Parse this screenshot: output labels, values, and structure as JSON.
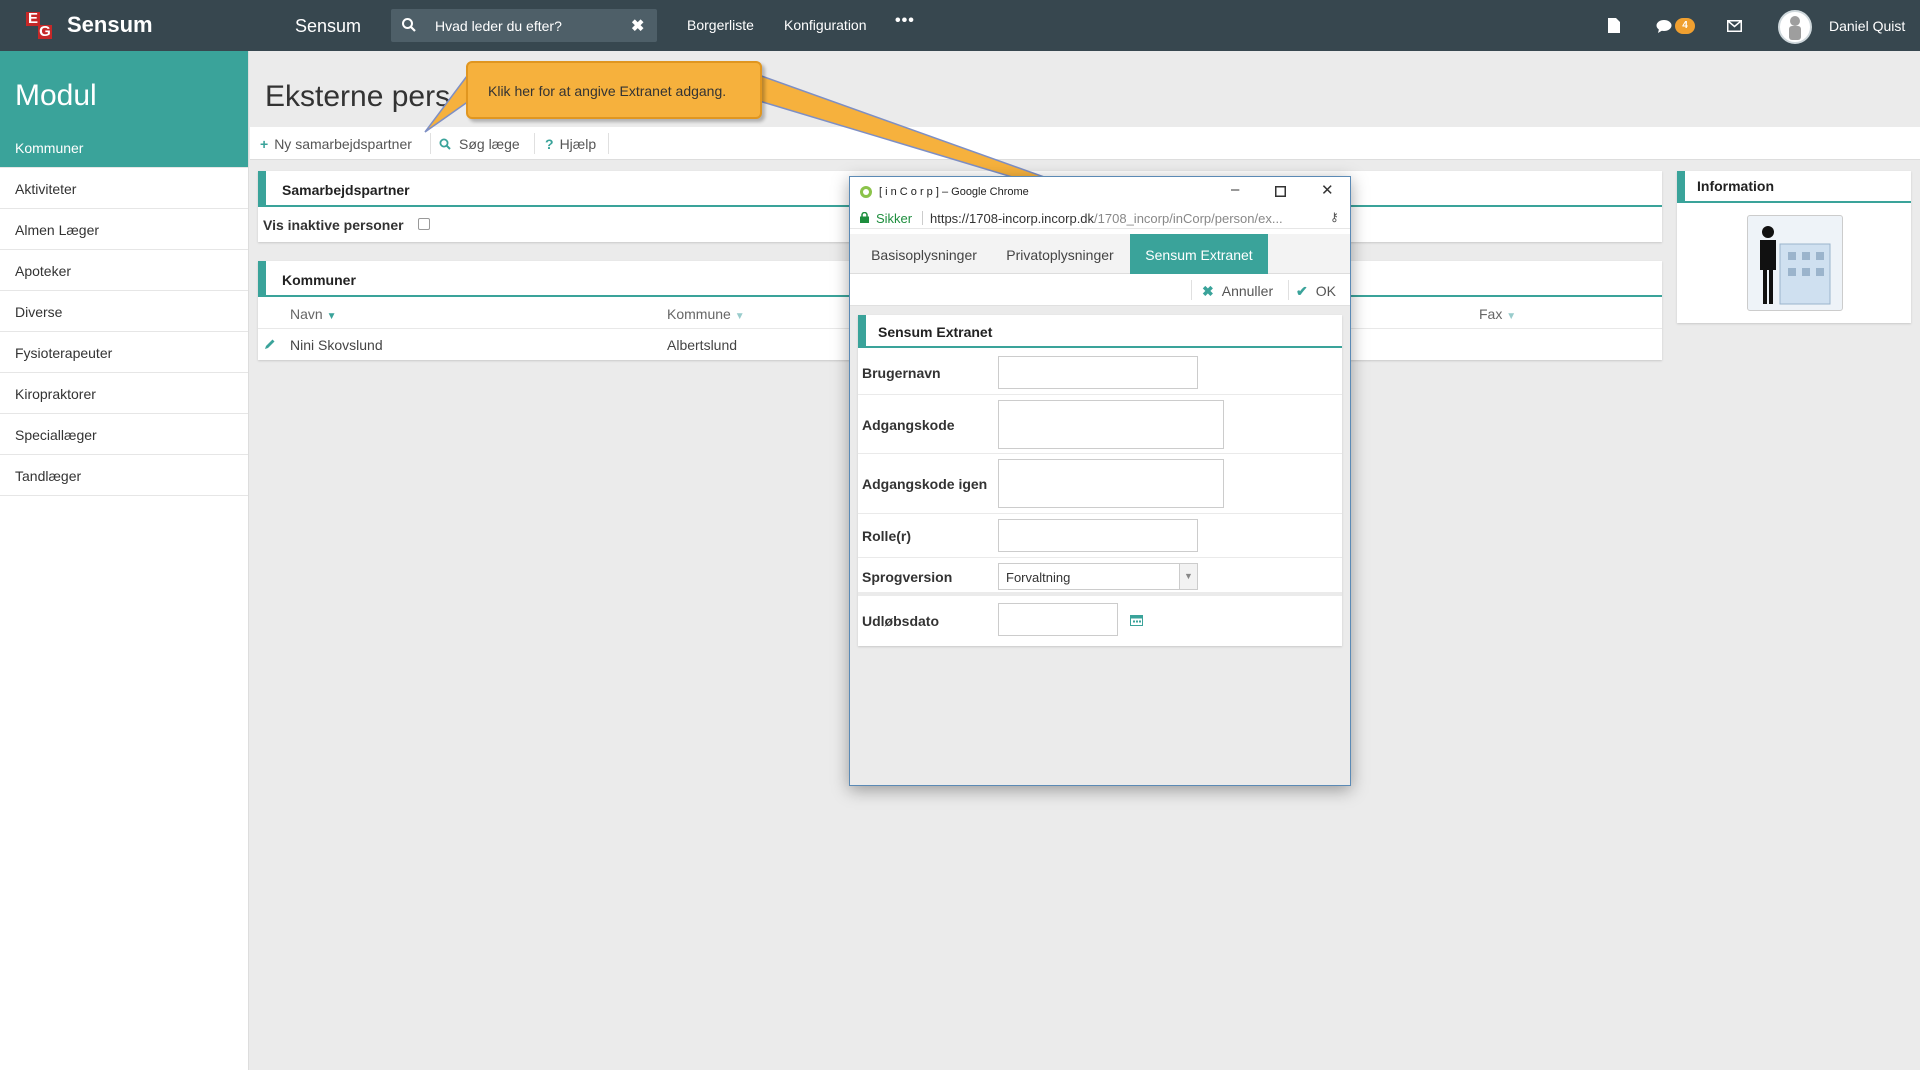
{
  "topbar": {
    "brand": "Sensum",
    "app_title": "Sensum",
    "search_placeholder": "Hvad leder du efter?",
    "nav": [
      "Borgerliste",
      "Konfiguration"
    ],
    "messages_badge": "4",
    "user_name": "Daniel Quist"
  },
  "sidebar": {
    "heading": "Modul",
    "items": [
      "Kommuner",
      "Aktiviteter",
      "Almen Læger",
      "Apoteker",
      "Diverse",
      "Fysioterapeuter",
      "Kiropraktorer",
      "Speciallæger",
      "Tandlæger"
    ],
    "active_index": 0
  },
  "main": {
    "title": "Eksterne pers",
    "toolbar": {
      "new_partner": "Ny samarbejdspartner",
      "search_doctor": "Søg læge",
      "help": "Hjælp"
    },
    "partner_panel": {
      "title": "Samarbejdspartner",
      "inactive_label": "Vis inaktive personer"
    },
    "kommuner_panel": {
      "title": "Kommuner",
      "columns": {
        "name": "Navn",
        "kommune": "Kommune",
        "fax": "Fax"
      },
      "rows": [
        {
          "name": "Nini Skovslund",
          "kommune": "Albertslund"
        }
      ]
    },
    "info_panel": {
      "title": "Information"
    }
  },
  "callout": {
    "text": "Klik her for at angive Extranet adgang."
  },
  "popup": {
    "window_title": "[ i n C o r p ] – Google Chrome",
    "secure_label": "Sikker",
    "url_main": "https://1708-incorp.incorp.dk",
    "url_rest": "/1708_incorp/inCorp/person/ex...",
    "tabs": [
      "Basisoplysninger",
      "Privatoplysninger",
      "Sensum Extranet"
    ],
    "active_tab": 2,
    "actions": {
      "cancel": "Annuller",
      "ok": "OK"
    },
    "form": {
      "title": "Sensum Extranet",
      "fields": {
        "username": "Brugernavn",
        "password": "Adgangskode",
        "password_again": "Adgangskode igen",
        "roles": "Rolle(r)",
        "language": "Sprogversion",
        "expiry": "Udløbsdato"
      },
      "language_value": "Forvaltning"
    }
  },
  "colors": {
    "accent": "#3aa39a",
    "topbar": "#37474f",
    "callout": "#f6b13d"
  }
}
